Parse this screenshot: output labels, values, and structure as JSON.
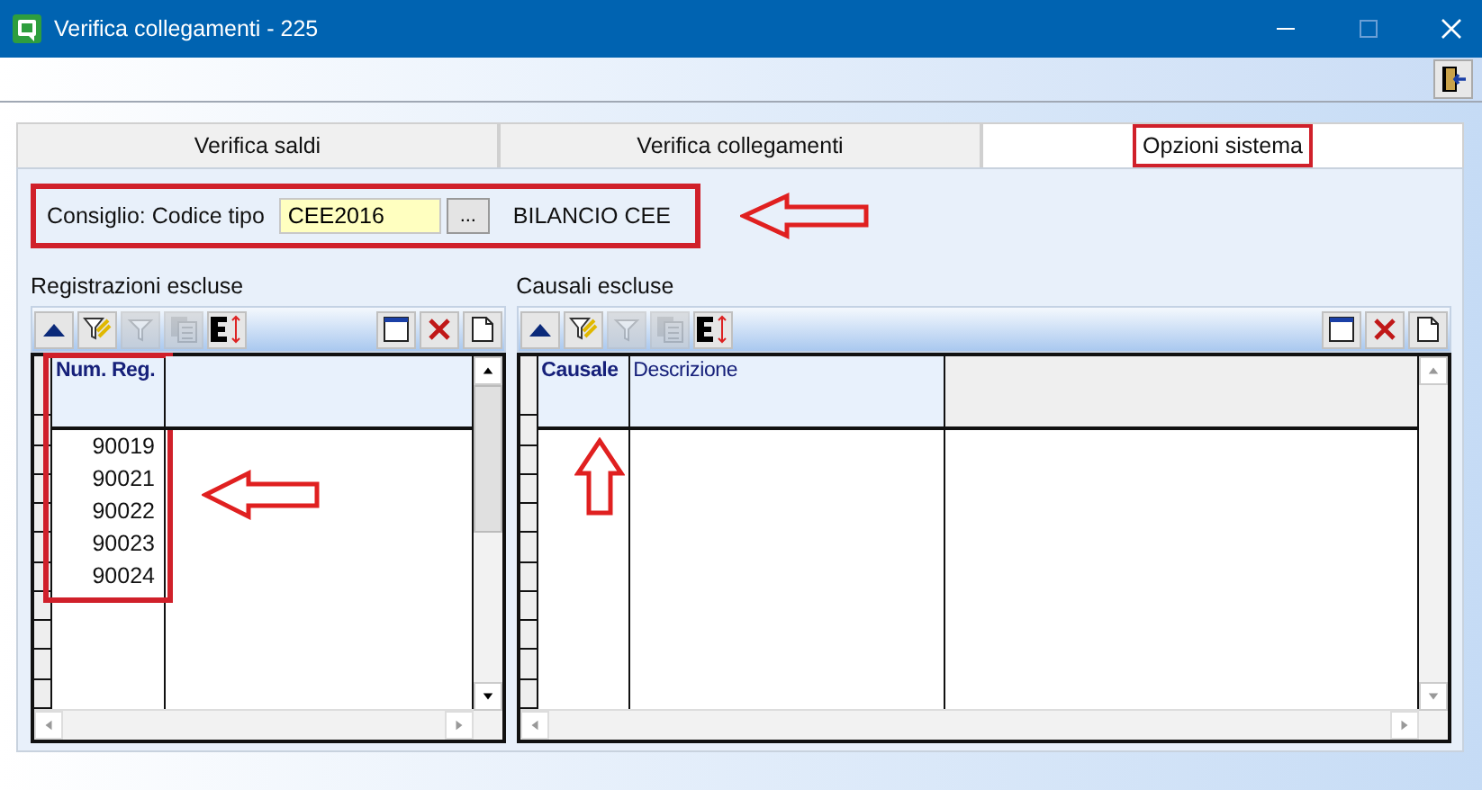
{
  "window": {
    "title": "Verifica collegamenti - 225"
  },
  "tabs": [
    {
      "label": "Verifica saldi",
      "selected": false,
      "highlighted": false
    },
    {
      "label": "Verifica collegamenti",
      "selected": false,
      "highlighted": false
    },
    {
      "label": "Opzioni sistema",
      "selected": true,
      "highlighted": true
    }
  ],
  "consiglio": {
    "label": "Consiglio: Codice tipo",
    "value": "CEE2016",
    "button": "...",
    "description": "BILANCIO CEE",
    "highlighted": true,
    "pointer": {
      "kind": "arrow-left"
    }
  },
  "grids": [
    {
      "title": "Registrazioni escluse",
      "pointer": {
        "kind": "arrow-left"
      },
      "toolbar": [
        {
          "kind": "sort-up",
          "disabled": false
        },
        {
          "kind": "filter-edit",
          "disabled": false
        },
        {
          "kind": "filter",
          "disabled": true
        },
        {
          "kind": "copy",
          "disabled": true
        },
        {
          "kind": "export",
          "disabled": false
        }
      ],
      "columns": [
        {
          "label": "Num. Reg.",
          "highlighted": true
        }
      ],
      "rows": [
        [
          "90019"
        ],
        [
          "90021"
        ],
        [
          "90022"
        ],
        [
          "90023"
        ],
        [
          "90024"
        ]
      ]
    },
    {
      "title": "Causali escluse",
      "pointer": {
        "kind": "arrow-up"
      },
      "toolbar": [
        {
          "kind": "sort-up",
          "disabled": false
        },
        {
          "kind": "filter-edit",
          "disabled": false
        },
        {
          "kind": "filter",
          "disabled": true
        },
        {
          "kind": "copy",
          "disabled": true
        },
        {
          "kind": "export",
          "disabled": false
        }
      ],
      "columns": [
        {
          "label": "Causale",
          "highlighted": false
        },
        {
          "label": "Descrizione",
          "highlighted": false
        }
      ]
    }
  ]
}
